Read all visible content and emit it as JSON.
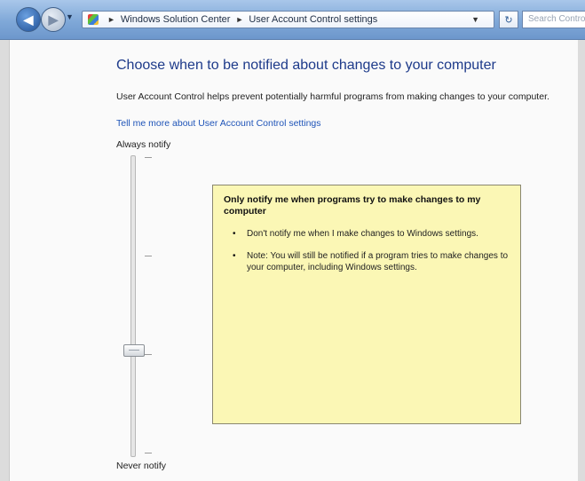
{
  "addressbar": {
    "crumbs": [
      "Windows Solution Center",
      "User Account Control settings"
    ],
    "search_placeholder": "Search Control Panel"
  },
  "page": {
    "title": "Choose when to be notified about changes to your computer",
    "description": "User Account Control helps prevent potentially harmful programs from making changes to your computer.",
    "link": "Tell me more about User Account Control settings"
  },
  "slider": {
    "top_label": "Always notify",
    "bottom_label": "Never notify",
    "levels": 4,
    "selected_level": 2
  },
  "info": {
    "title": "Only notify me when programs try to make changes to my computer",
    "bullets": [
      "Don't notify me when I make changes to Windows settings.",
      "Note: You will still be notified if a program tries to make changes to your computer, including Windows settings."
    ]
  },
  "icons": {
    "back": "back-arrow-icon",
    "forward": "forward-arrow-icon",
    "address": "control-panel-icon",
    "refresh": "refresh-icon"
  }
}
